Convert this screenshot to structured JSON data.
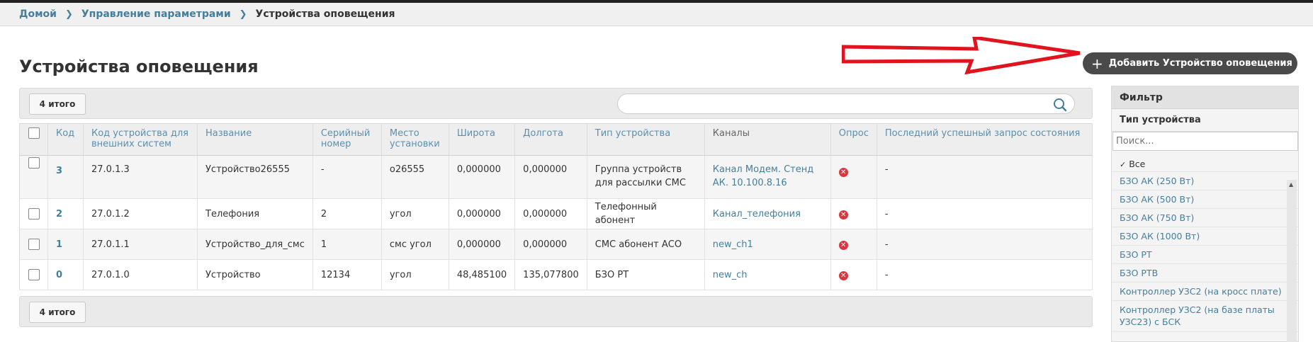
{
  "breadcrumbs": {
    "home": "Домой",
    "params": "Управление параметрами",
    "current": "Устройства оповещения",
    "separator": ">"
  },
  "page": {
    "title": "Устройства оповещения",
    "add_button": "Добавить Устройство оповещения"
  },
  "toolbar": {
    "total_label": "4 итого",
    "search_placeholder": ""
  },
  "table": {
    "headers": {
      "code": "Код",
      "external_code": "Код устройства для внешних систем",
      "name": "Название",
      "serial": "Серийный номер",
      "location": "Место установки",
      "latitude": "Широта",
      "longitude": "Долгота",
      "type": "Тип устройства",
      "channels": "Каналы",
      "poll": "Опрос",
      "last_request": "Последний успешный запрос состояния"
    },
    "rows": [
      {
        "code": "3",
        "external_code": "27.0.1.3",
        "name": "Устройство26555",
        "serial": "-",
        "location": "о26555",
        "latitude": "0,000000",
        "longitude": "0,000000",
        "type": "Группа устройств для рассылки СМС",
        "channel": "Канал Модем. Стенд АК. 10.100.8.16",
        "last_request": "-"
      },
      {
        "code": "2",
        "external_code": "27.0.1.2",
        "name": "Телефония",
        "serial": "2",
        "location": "угол",
        "latitude": "0,000000",
        "longitude": "0,000000",
        "type": "Телефонный абонент",
        "channel": "Канал_телефония",
        "last_request": "-"
      },
      {
        "code": "1",
        "external_code": "27.0.1.1",
        "name": "Устройство_для_смс",
        "serial": "1",
        "location": "смс угол",
        "latitude": "0,000000",
        "longitude": "0,000000",
        "type": "СМС абонент АСО",
        "channel": "new_ch1",
        "last_request": "-"
      },
      {
        "code": "0",
        "external_code": "27.0.1.0",
        "name": "Устройство",
        "serial": "12134",
        "location": "угол",
        "latitude": "48,485100",
        "longitude": "135,077800",
        "type": "БЗО РТ",
        "channel": "new_ch",
        "last_request": "-"
      }
    ]
  },
  "filter": {
    "title": "Фильтр",
    "section": "Тип устройства",
    "search_placeholder": "Поиск...",
    "items": [
      "Все",
      "БЗО АК (250 Вт)",
      "БЗО АК (500 Вт)",
      "БЗО АК (750 Вт)",
      "БЗО АК (1000 Вт)",
      "БЗО РТ",
      "БЗО РТВ",
      "Контроллер УЗС2 (на кросс плате)",
      "Контроллер УЗС2 (на базе платы УЗС23) с БСК"
    ]
  },
  "colors": {
    "link": "#447e9b",
    "header_text": "#5b8fae",
    "button_bg": "#4a4a4a",
    "error": "#d9363e",
    "arrow": "#e0141e"
  },
  "icons": {
    "poll_status": "error-circle-icon",
    "search": "search-icon",
    "add": "plus-icon"
  }
}
